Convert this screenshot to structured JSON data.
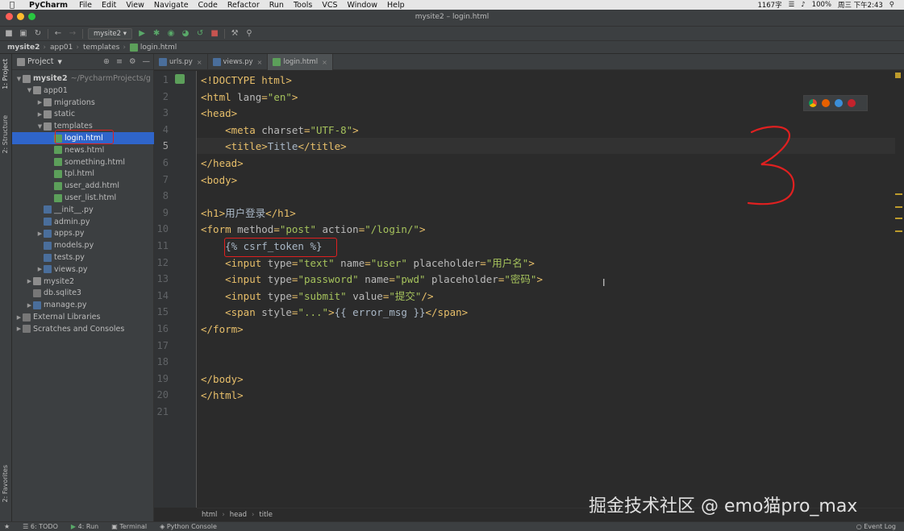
{
  "menubar": {
    "app": "PyCharm",
    "items": [
      "File",
      "Edit",
      "View",
      "Navigate",
      "Code",
      "Refactor",
      "Run",
      "Tools",
      "VCS",
      "Window",
      "Help"
    ],
    "window_title": "mysite2 – login.html",
    "word_count": "1167字",
    "battery": "100%",
    "clock": "周三 下午2:43"
  },
  "toolbar": {
    "run_config": "mysite2"
  },
  "breadcrumb": [
    "mysite2",
    "app01",
    "templates",
    "login.html"
  ],
  "project_panel": {
    "title": "Project",
    "root_name": "mysite2",
    "root_path": "~/PycharmProjects/g",
    "tree": [
      {
        "label": "app01",
        "type": "folder",
        "depth": 1,
        "open": true
      },
      {
        "label": "migrations",
        "type": "folder",
        "depth": 2,
        "open": false
      },
      {
        "label": "static",
        "type": "folder",
        "depth": 2,
        "open": false
      },
      {
        "label": "templates",
        "type": "folder",
        "depth": 2,
        "open": true
      },
      {
        "label": "login.html",
        "type": "html",
        "depth": 3,
        "selected": true
      },
      {
        "label": "news.html",
        "type": "html",
        "depth": 3
      },
      {
        "label": "something.html",
        "type": "html",
        "depth": 3
      },
      {
        "label": "tpl.html",
        "type": "html",
        "depth": 3
      },
      {
        "label": "user_add.html",
        "type": "html",
        "depth": 3
      },
      {
        "label": "user_list.html",
        "type": "html",
        "depth": 3
      },
      {
        "label": "__init__.py",
        "type": "py",
        "depth": 2
      },
      {
        "label": "admin.py",
        "type": "py",
        "depth": 2
      },
      {
        "label": "apps.py",
        "type": "py",
        "depth": 2,
        "open": false
      },
      {
        "label": "models.py",
        "type": "py",
        "depth": 2
      },
      {
        "label": "tests.py",
        "type": "py",
        "depth": 2
      },
      {
        "label": "views.py",
        "type": "py",
        "depth": 2,
        "open": false
      },
      {
        "label": "mysite2",
        "type": "folder",
        "depth": 1,
        "open": false
      },
      {
        "label": "db.sqlite3",
        "type": "db",
        "depth": 1
      },
      {
        "label": "manage.py",
        "type": "py",
        "depth": 1,
        "open": false
      },
      {
        "label": "External Libraries",
        "type": "lib",
        "depth": 0,
        "open": false
      },
      {
        "label": "Scratches and Consoles",
        "type": "lib",
        "depth": 0,
        "open": false
      }
    ]
  },
  "left_tabs": [
    "1: Project",
    "2: Structure",
    "2: Favorites"
  ],
  "editor_tabs": [
    {
      "label": "urls.py",
      "active": false
    },
    {
      "label": "views.py",
      "active": false
    },
    {
      "label": "login.html",
      "active": true
    }
  ],
  "code_lines": [
    "<!DOCTYPE html>",
    "<html lang=\"en\">",
    "<head>",
    "    <meta charset=\"UTF-8\">",
    "    <title>Title</title>",
    "</head>",
    "<body>",
    "",
    "<h1>用户登录</h1>",
    "<form method=\"post\" action=\"/login/\">",
    "    {% csrf_token %}",
    "    <input type=\"text\" name=\"user\" placeholder=\"用户名\">",
    "    <input type=\"password\" name=\"pwd\" placeholder=\"密码\">",
    "    <input type=\"submit\" value=\"提交\"/>",
    "    <span style=\"...\">{{ error_msg }}</span>",
    "</form>",
    "",
    "",
    "</body>",
    "</html>",
    ""
  ],
  "annotation": "3",
  "editor_breadcrumb": [
    "html",
    "head",
    "title"
  ],
  "statusbar": [
    "6: TODO",
    "4: Run",
    "Terminal",
    "Python Console",
    "Event Log"
  ],
  "watermark": "掘金技术社区 @ emo猫pro_max",
  "colors": {
    "accent_selected": "#2f65ca",
    "annotation_red": "#e02020",
    "tag": "#e8bf6a",
    "attr_value": "#a5c25c"
  }
}
